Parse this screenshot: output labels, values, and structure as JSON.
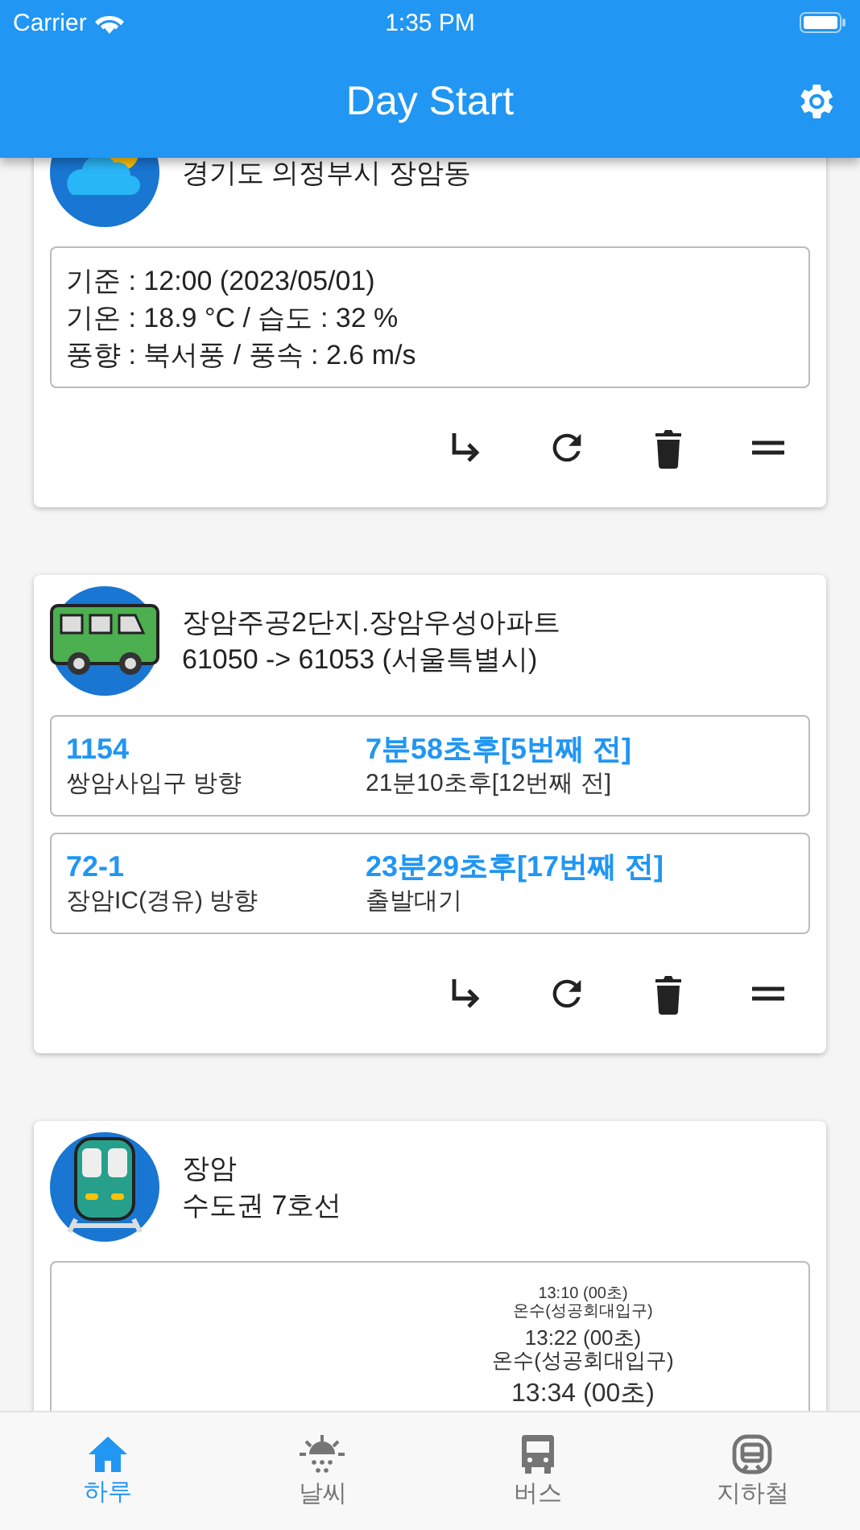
{
  "status_bar": {
    "carrier": "Carrier",
    "time": "1:35 PM"
  },
  "app_bar": {
    "title": "Day Start"
  },
  "cards": [
    {
      "kind": "weather",
      "title_lines": [
        "경기도 의정부시 장암동"
      ],
      "details": [
        "기준 : 12:00 (2023/05/01)",
        "기온 : 18.9 °C / 습도 : 32 %",
        "풍향 : 북서풍 / 풍속 : 2.6 m/s"
      ]
    },
    {
      "kind": "bus",
      "title_lines": [
        "장암주공2단지.장암우성아파트",
        "61050 -> 61053 (서울특별시)"
      ],
      "routes": [
        {
          "number": "1154",
          "direction": "쌍암사입구 방향",
          "first_arrival": "7분58초후[5번째 전]",
          "second_arrival": "21분10초후[12번째 전]"
        },
        {
          "number": "72-1",
          "direction": "장암IC(경유) 방향",
          "first_arrival": "23분29초후[17번째 전]",
          "second_arrival": "출발대기"
        }
      ]
    },
    {
      "kind": "subway",
      "title_lines": [
        "장암",
        "수도권 7호선"
      ],
      "arrivals": [
        {
          "time": "13:10 (00초)",
          "destination": "온수(성공회대입구)"
        },
        {
          "time": "13:22 (00초)",
          "destination": "온수(성공회대입구)"
        },
        {
          "time": "13:34 (00초)"
        }
      ]
    }
  ],
  "tabs": [
    {
      "label": "하루",
      "selected": true
    },
    {
      "label": "날씨",
      "selected": false
    },
    {
      "label": "버스",
      "selected": false
    },
    {
      "label": "지하철",
      "selected": false
    }
  ]
}
